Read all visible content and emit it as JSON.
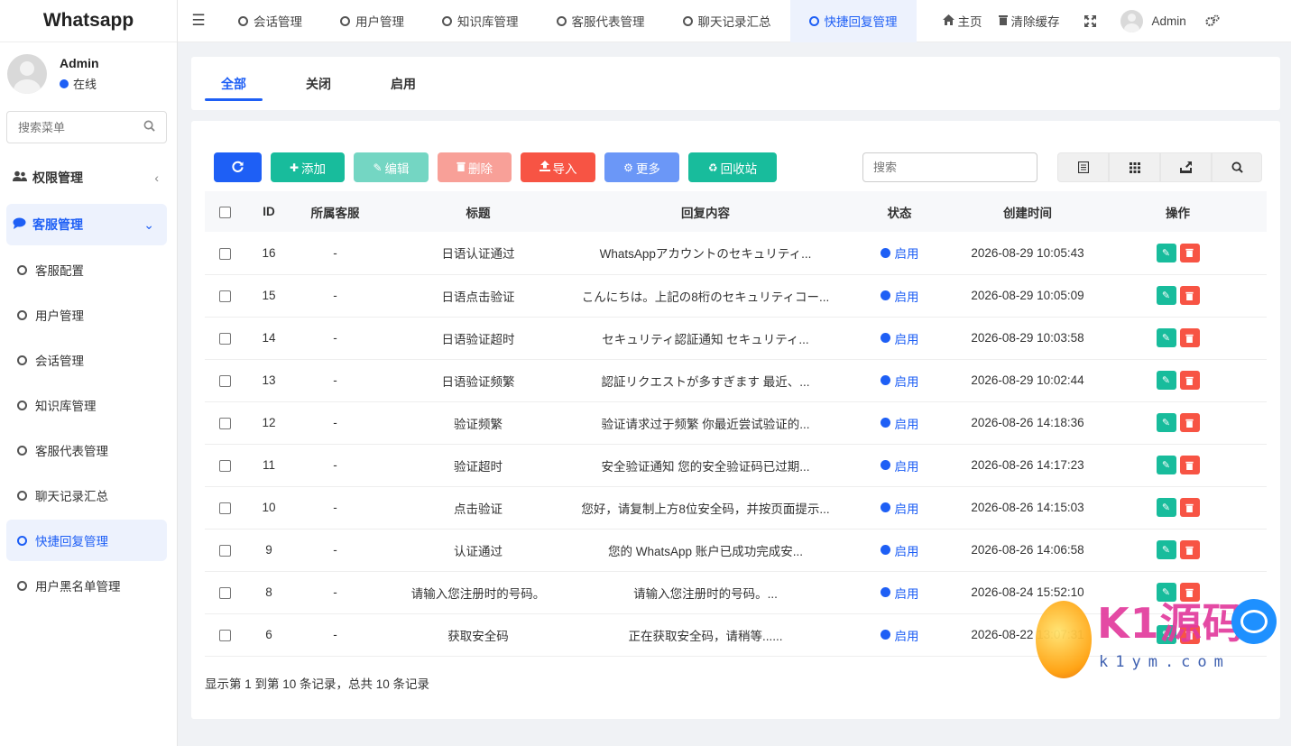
{
  "app": {
    "title": "Whatsapp"
  },
  "sidebar": {
    "user": {
      "name": "Admin",
      "status": "在线",
      "status_color": "#1e5ff5"
    },
    "search_placeholder": "搜索菜单",
    "groups": [
      {
        "label": "权限管理",
        "icon": "users-icon",
        "arrow": "‹",
        "active": false
      },
      {
        "label": "客服管理",
        "icon": "comment-icon",
        "arrow": "⌄",
        "active": true
      }
    ],
    "items": [
      {
        "label": "客服配置",
        "active": false
      },
      {
        "label": "用户管理",
        "active": false
      },
      {
        "label": "会话管理",
        "active": false
      },
      {
        "label": "知识库管理",
        "active": false
      },
      {
        "label": "客服代表管理",
        "active": false
      },
      {
        "label": "聊天记录汇总",
        "active": false
      },
      {
        "label": "快捷回复管理",
        "active": true
      },
      {
        "label": "用户黑名单管理",
        "active": false
      }
    ]
  },
  "topbar": {
    "tabs": [
      {
        "label": "会话管理",
        "active": false
      },
      {
        "label": "用户管理",
        "active": false
      },
      {
        "label": "知识库管理",
        "active": false
      },
      {
        "label": "客服代表管理",
        "active": false
      },
      {
        "label": "聊天记录汇总",
        "active": false
      },
      {
        "label": "快捷回复管理",
        "active": true
      }
    ],
    "home_label": "主页",
    "clear_cache_label": "清除缓存",
    "user_label": "Admin"
  },
  "filter_tabs": [
    {
      "label": "全部",
      "active": true
    },
    {
      "label": "关闭",
      "active": false
    },
    {
      "label": "启用",
      "active": false
    }
  ],
  "toolbar": {
    "refresh_icon": "refresh-icon",
    "add_label": "添加",
    "edit_label": "编辑",
    "delete_label": "删除",
    "import_label": "导入",
    "more_label": "更多",
    "recycle_label": "回收站",
    "search_placeholder": "搜索",
    "colors": {
      "refresh": "#1e5ff5",
      "add": "#18bc9c",
      "edit": "#74d6c3",
      "delete": "#f8a098",
      "import": "#f75444",
      "more": "#6b97f7",
      "recycle": "#18bc9c"
    }
  },
  "table": {
    "headers": [
      "ID",
      "所属客服",
      "标题",
      "回复内容",
      "状态",
      "创建时间",
      "操作"
    ],
    "rows": [
      {
        "id": "16",
        "agent": "-",
        "title": "日语认证通过",
        "content": "WhatsAppアカウントのセキュリティ...",
        "status": "启用",
        "created": "2026-08-29 10:05:43"
      },
      {
        "id": "15",
        "agent": "-",
        "title": "日语点击验证",
        "content": "こんにちは。上記の8桁のセキュリティコー...",
        "status": "启用",
        "created": "2026-08-29 10:05:09"
      },
      {
        "id": "14",
        "agent": "-",
        "title": "日语验证超时",
        "content": "セキュリティ認証通知 セキュリティ...",
        "status": "启用",
        "created": "2026-08-29 10:03:58"
      },
      {
        "id": "13",
        "agent": "-",
        "title": "日语验证频繁",
        "content": "認証リクエストが多すぎます 最近、...",
        "status": "启用",
        "created": "2026-08-29 10:02:44"
      },
      {
        "id": "12",
        "agent": "-",
        "title": "验证频繁",
        "content": "验证请求过于频繁 你最近尝试验证的...",
        "status": "启用",
        "created": "2026-08-26 14:18:36"
      },
      {
        "id": "11",
        "agent": "-",
        "title": "验证超时",
        "content": "安全验证通知 您的安全验证码已过期...",
        "status": "启用",
        "created": "2026-08-26 14:17:23"
      },
      {
        "id": "10",
        "agent": "-",
        "title": "点击验证",
        "content": "您好，请复制上方8位安全码，并按页面提示...",
        "status": "启用",
        "created": "2026-08-26 14:15:03"
      },
      {
        "id": "9",
        "agent": "-",
        "title": "认证通过",
        "content": "您的 WhatsApp 账户已成功完成安...",
        "status": "启用",
        "created": "2026-08-26 14:06:58"
      },
      {
        "id": "8",
        "agent": "-",
        "title": "请输入您注册时的号码。",
        "content": "请输入您注册时的号码。...",
        "status": "启用",
        "created": "2026-08-24 15:52:10"
      },
      {
        "id": "6",
        "agent": "-",
        "title": "获取安全码",
        "content": "正在获取安全码，请稍等......",
        "status": "启用",
        "created": "2026-08-22 13:07:31"
      }
    ]
  },
  "pagination": {
    "info": "显示第 1 到第 10 条记录，总共 10 条记录"
  },
  "watermark": {
    "text": "K1源码",
    "sub": "k1ym.com"
  }
}
